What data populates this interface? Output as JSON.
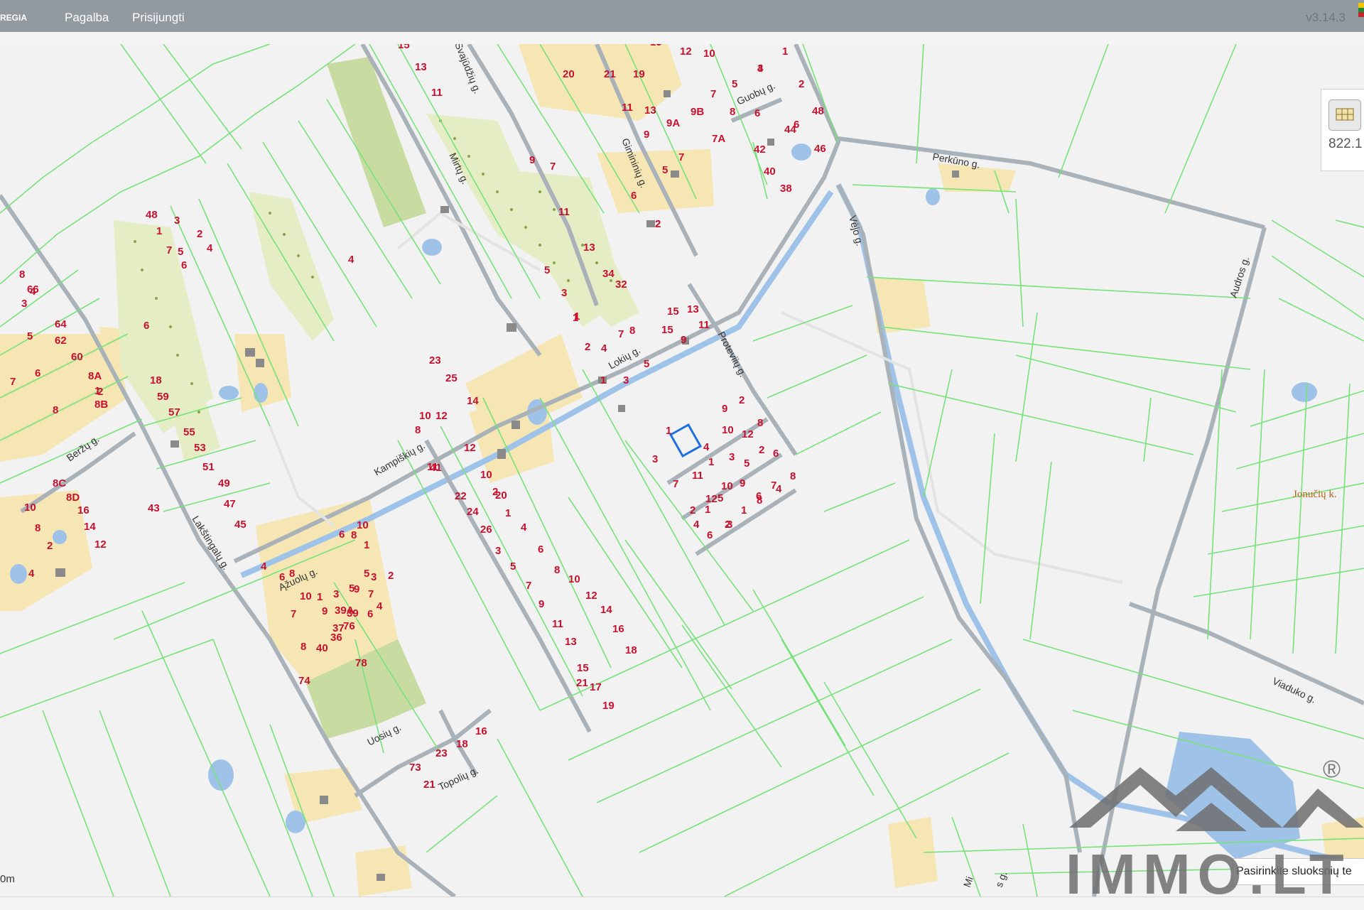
{
  "topbar": {
    "brand": "REGIA",
    "menu": [
      "Pagalba",
      "Prisijungti"
    ],
    "version": "v3.14.3"
  },
  "side_panel": {
    "icon": "map-layers-icon",
    "value": "822.1"
  },
  "scale_label": "0m",
  "layer_hint": "Pasirinkite sluoksnių te",
  "watermark": {
    "text": "IMMO.LT",
    "registered": "®"
  },
  "colors": {
    "parcel_line": "#77e27a",
    "road": "#a9b2b8",
    "water": "#9fc3e8",
    "label": "#c8102e",
    "selection": "#1e6fe0",
    "sand": "#f5e6b4",
    "forest": "#d7e4a6"
  },
  "streets": [
    "Lakštingalų g.",
    "Beržų g.",
    "Kampiškių g.",
    "Ąžuolų g.",
    "Uosių g.",
    "Topolių g.",
    "Lokių g.",
    "Proteviių g.",
    "Vėjo g.",
    "Perkūno g.",
    "Audros g.",
    "Viaduko g.",
    "Mirtų g.",
    "Gimininių g.",
    "Guobų g.",
    "Svajūdžių g.",
    "Mi",
    "s g."
  ],
  "village": "Jonučių k.",
  "parcel_numbers": [
    "15",
    "13",
    "11",
    "12",
    "10",
    "1",
    "20",
    "21",
    "19",
    "15",
    "3",
    "2",
    "48",
    "17",
    "11",
    "13",
    "9B",
    "7",
    "5",
    "4",
    "9",
    "9A",
    "8",
    "6",
    "44",
    "7A",
    "42",
    "46",
    "7",
    "40",
    "38",
    "5",
    "9",
    "7",
    "6",
    "2",
    "11",
    "2",
    "13",
    "34",
    "32",
    "1",
    "5",
    "3",
    "1",
    "15",
    "13",
    "11",
    "9",
    "6",
    "7",
    "8",
    "4",
    "2",
    "5",
    "1",
    "3",
    "15",
    "1",
    "2",
    "9",
    "8",
    "12",
    "10",
    "2",
    "4",
    "1",
    "3",
    "5",
    "6",
    "8",
    "3",
    "7",
    "11",
    "12",
    "10",
    "9",
    "6",
    "4",
    "2",
    "1",
    "5",
    "3",
    "1",
    "8",
    "7",
    "6",
    "4",
    "2",
    "12",
    "11",
    "10",
    "2",
    "1",
    "4",
    "6",
    "8",
    "10",
    "12",
    "14",
    "16",
    "18",
    "20",
    "22",
    "24",
    "26",
    "3",
    "5",
    "7",
    "9",
    "11",
    "13",
    "15",
    "17",
    "19",
    "21",
    "23",
    "25",
    "14",
    "12",
    "10",
    "8",
    "4",
    "6",
    "18",
    "59",
    "57",
    "55",
    "53",
    "51",
    "49",
    "47",
    "45",
    "43",
    "41",
    "48",
    "1",
    "3",
    "5",
    "7",
    "2",
    "4",
    "6",
    "8",
    "66",
    "64",
    "62",
    "60",
    "2",
    "1",
    "3",
    "4",
    "5",
    "6",
    "7",
    "8",
    "8A",
    "8B",
    "8C",
    "8D",
    "16",
    "14",
    "12",
    "10",
    "8",
    "2",
    "4",
    "6",
    "8",
    "10",
    "1",
    "3",
    "5",
    "7",
    "9",
    "2",
    "4",
    "6",
    "8",
    "10",
    "1",
    "3",
    "5",
    "7",
    "9",
    "39A",
    "39",
    "37",
    "4",
    "6",
    "8",
    "40",
    "36",
    "76",
    "74",
    "78",
    "73",
    "21",
    "23",
    "18",
    "16"
  ]
}
